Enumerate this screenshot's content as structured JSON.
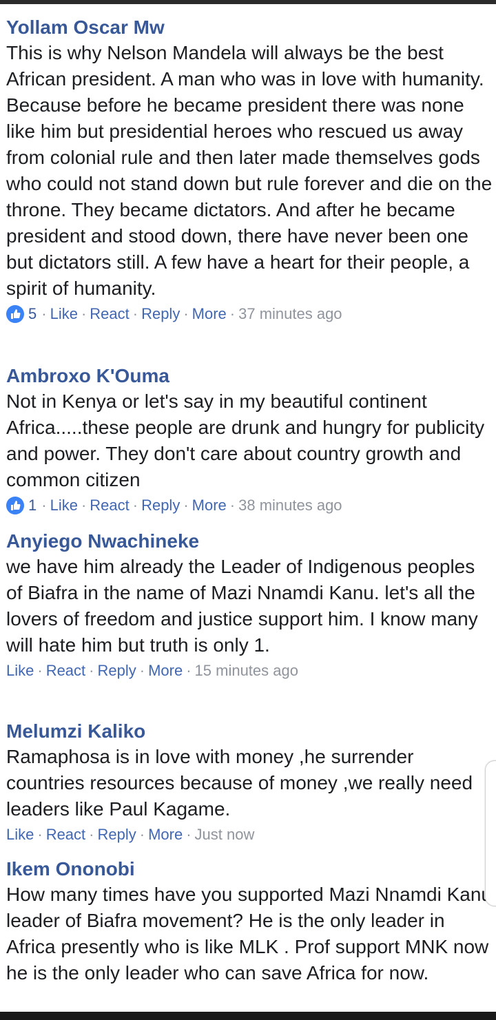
{
  "comments": [
    {
      "author": "Yollam Oscar Mw",
      "text": "This is why Nelson Mandela will always be the best African president. A man who was in love with humanity. Because before he became president there was none like him but presidential heroes who rescued us away from colonial rule and then later made themselves gods who could not stand down but rule forever and die on the throne. They became dictators. And after he became president and stood down, there have never been one but dictators still. A few have a heart for their people, a spirit of humanity.",
      "likes": "5",
      "like_label": "Like",
      "react_label": "React",
      "reply_label": "Reply",
      "more_label": "More",
      "time": "37 minutes ago"
    },
    {
      "author": "Ambroxo K'Ouma",
      "text": "Not in Kenya or let's say in my beautiful continent Africa.....these people are drunk and hungry for publicity and power. They don't care about country growth and common citizen",
      "likes": "1",
      "like_label": "Like",
      "react_label": "React",
      "reply_label": "Reply",
      "more_label": "More",
      "time": "38 minutes ago"
    },
    {
      "author": "Anyiego Nwachineke",
      "text": "we have him already the Leader of Indigenous peoples of Biafra in the name of Mazi Nnamdi Kanu. let's all the lovers of freedom and justice support him. I know many will hate him but truth is only 1.",
      "like_label": "Like",
      "react_label": "React",
      "reply_label": "Reply",
      "more_label": "More",
      "time": "15 minutes ago"
    },
    {
      "author": "Melumzi Kaliko",
      "text": "Ramaphosa is in love with money ,he surrender countries resources because of money ,we really need leaders like Paul Kagame.",
      "like_label": "Like",
      "react_label": "React",
      "reply_label": "Reply",
      "more_label": "More",
      "time": "Just now"
    },
    {
      "author": "Ikem Ononobi",
      "text": "How many times have you supported Mazi Nnamdi Kanu leader of Biafra movement? He is the only leader in Africa presently who is like MLK . Prof support MNK now he is the only leader who can save Africa for now."
    }
  ],
  "colors": {
    "author": "#385898",
    "action": "#4267b2",
    "meta": "#90949c",
    "like_badge": "#3b82f6",
    "text": "#1c1e21"
  },
  "icons": {
    "like_badge": "thumbs-up-icon"
  }
}
